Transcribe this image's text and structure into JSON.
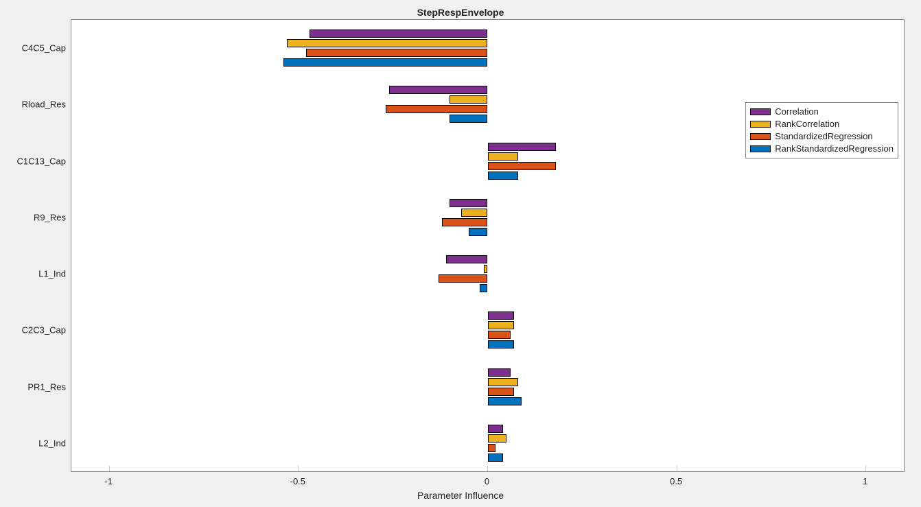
{
  "chart_data": {
    "type": "bar",
    "orientation": "horizontal-grouped",
    "title": "StepRespEnvelope",
    "xlabel": "Parameter Influence",
    "ylabel": "",
    "xlim": [
      -1.1,
      1.1
    ],
    "xticks": [
      -1,
      -0.5,
      0,
      0.5,
      1
    ],
    "legend_position": "upper-right",
    "categories": [
      "C4C5_Cap",
      "Rload_Res",
      "C1C13_Cap",
      "R9_Res",
      "L1_Ind",
      "C2C3_Cap",
      "PR1_Res",
      "L2_Ind"
    ],
    "series": [
      {
        "name": "Correlation",
        "color": "#7E2F8E",
        "values": [
          -0.47,
          -0.26,
          0.18,
          -0.1,
          -0.11,
          0.07,
          0.06,
          0.04
        ]
      },
      {
        "name": "RankCorrelation",
        "color": "#EDB120",
        "values": [
          -0.53,
          -0.1,
          0.08,
          -0.07,
          -0.01,
          0.07,
          0.08,
          0.05
        ]
      },
      {
        "name": "StandardizedRegression",
        "color": "#D95319",
        "values": [
          -0.48,
          -0.27,
          0.18,
          -0.12,
          -0.13,
          0.06,
          0.07,
          0.02
        ]
      },
      {
        "name": "RankStandardizedRegression",
        "color": "#0072BD",
        "values": [
          -0.54,
          -0.1,
          0.08,
          -0.05,
          -0.02,
          0.07,
          0.09,
          0.04
        ]
      }
    ]
  }
}
